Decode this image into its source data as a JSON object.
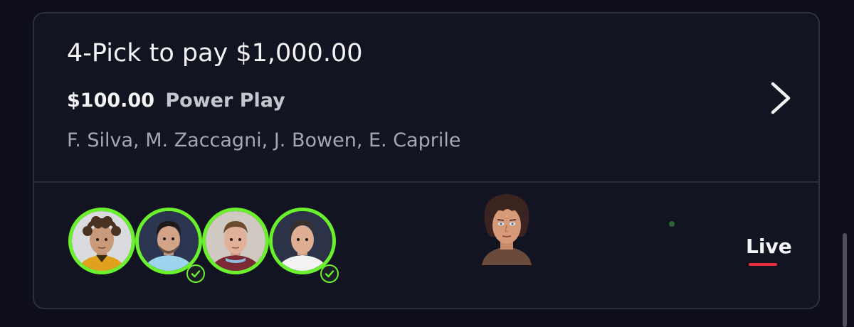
{
  "entry": {
    "title": "4-Pick to pay $1,000.00",
    "amount": "$100.00",
    "play_type": "Power Play",
    "players": "F. Silva, M. Zaccagni, J. Bowen, E. Caprile",
    "status": "Live"
  },
  "avatars": [
    {
      "name": "F. Silva",
      "checked": false
    },
    {
      "name": "M. Zaccagni",
      "checked": true
    },
    {
      "name": "J. Bowen",
      "checked": false
    },
    {
      "name": "E. Caprile",
      "checked": true
    }
  ],
  "icons": {
    "chevron": "chevron-right-icon",
    "check": "check-circle-icon"
  },
  "colors": {
    "background": "#0e0f1b",
    "card": "#131421",
    "accent_green": "#6af02c",
    "live_red": "#ea2d3a",
    "text_primary": "#f4f4f7",
    "text_secondary": "#a6a7b2"
  }
}
